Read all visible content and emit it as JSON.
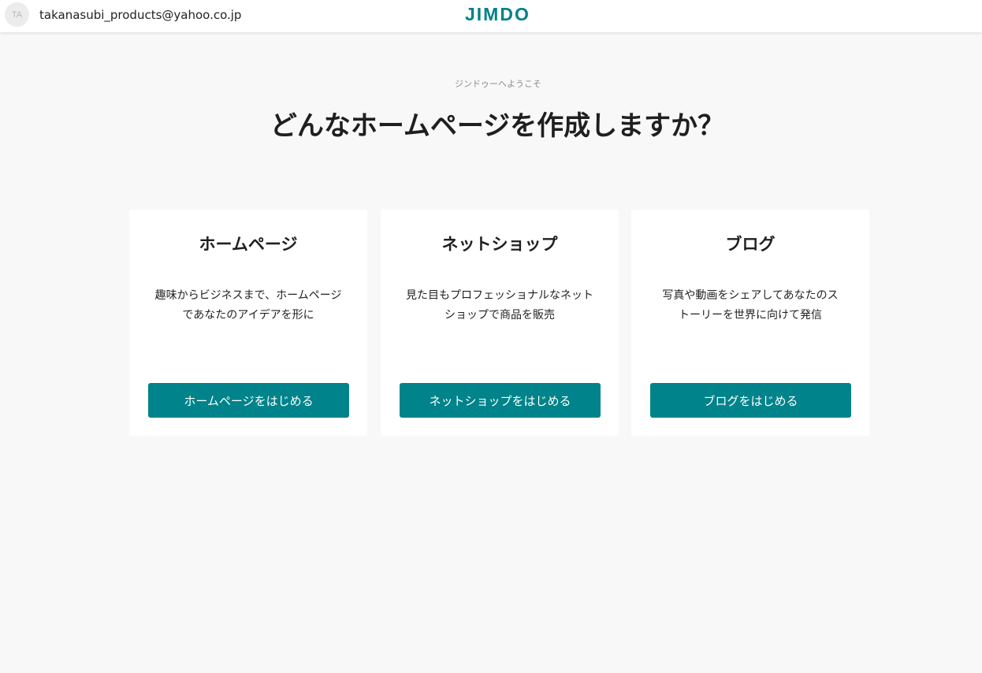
{
  "header": {
    "avatar_initials": "TA",
    "account_email": "takanasubi_products@yahoo.co.jp",
    "logo_text": "JIMDO",
    "brand_color": "#00818a"
  },
  "intro": {
    "welcome": "ジンドゥーへようこそ",
    "headline": "どんなホームページを作成しますか？"
  },
  "cards": [
    {
      "title": "ホームページ",
      "desc_line1": "趣味からビジネスまで、ホームページ",
      "desc_line2": "であなたのアイデアを形に",
      "button": "ホームページをはじめる"
    },
    {
      "title": "ネットショップ",
      "desc_line1": "見た目もプロフェッショナルなネット",
      "desc_line2": "ショップで商品を販売",
      "button": "ネットショップをはじめる"
    },
    {
      "title": "ブログ",
      "desc_line1": "写真や動画をシェアしてあなたのス",
      "desc_line2": "トーリーを世界に向けて発信",
      "button": "ブログをはじめる"
    }
  ],
  "colors": {
    "button_bg": "#00838a",
    "page_bg": "#f8f8f8",
    "card_bg": "#ffffff"
  }
}
